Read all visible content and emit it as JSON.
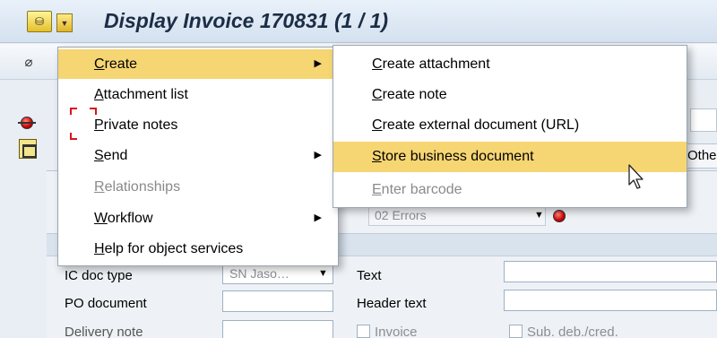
{
  "window": {
    "title": "Display Invoice 170831 (1 / 1)"
  },
  "form": {
    "status_value": "02 Errors",
    "ic_doc_type_label": "IC doc type",
    "ic_doc_type_value": "SN Jaso…",
    "po_document_label": "PO document",
    "delivery_note_label": "Delivery note",
    "text_label": "Text",
    "header_text_label": "Header text",
    "invoice_checkbox_label": "Invoice",
    "sub_deb_label": "Sub. deb./cred.",
    "side_tab_label": "Other"
  },
  "menu_main": {
    "items": [
      {
        "label": "Create",
        "mnemonic": "C",
        "rest": "reate",
        "submenu": true,
        "disabled": false,
        "highlight": true
      },
      {
        "label": "Attachment list",
        "mnemonic": "A",
        "rest": "ttachment list",
        "submenu": false,
        "disabled": false
      },
      {
        "label": "Private notes",
        "mnemonic": "P",
        "rest": "rivate notes",
        "submenu": false,
        "disabled": false
      },
      {
        "label": "Send",
        "mnemonic": "S",
        "rest": "end",
        "submenu": true,
        "disabled": false
      },
      {
        "label": "Relationships",
        "mnemonic": "R",
        "rest": "elationships",
        "submenu": false,
        "disabled": true
      },
      {
        "label": "Workflow",
        "mnemonic": "W",
        "rest": "orkflow",
        "submenu": true,
        "disabled": false
      },
      {
        "label": "Help for object services",
        "mnemonic": "H",
        "rest": "elp for object services",
        "submenu": false,
        "disabled": false
      }
    ]
  },
  "menu_sub": {
    "items": [
      {
        "label": "Create attachment",
        "mnemonic": "C",
        "rest": "reate attachment",
        "disabled": false
      },
      {
        "label": "Create note",
        "mnemonic": "C",
        "rest": "reate note",
        "disabled": false
      },
      {
        "label": "Create external document (URL)",
        "mnemonic": "C",
        "rest": "reate external document (URL)",
        "disabled": false
      },
      {
        "label": "Store business document",
        "mnemonic": "S",
        "rest": "tore business document",
        "disabled": false,
        "highlight": true
      },
      {
        "label": "Enter barcode",
        "mnemonic": "E",
        "rest": "nter barcode",
        "disabled": true
      }
    ]
  },
  "colors": {
    "highlight": "#f6d573",
    "title_text": "#1c2d46",
    "focus_bracket": "#d9141a"
  },
  "icons": {
    "title_services": "services-for-object-icon",
    "title_dropdown": "dropdown-arrow-icon",
    "toolbar_first": "glasses-display-icon",
    "status_light": "red-status-icon",
    "header_toggle": "header-toggle-icon",
    "cursor": "mouse-pointer-icon"
  }
}
